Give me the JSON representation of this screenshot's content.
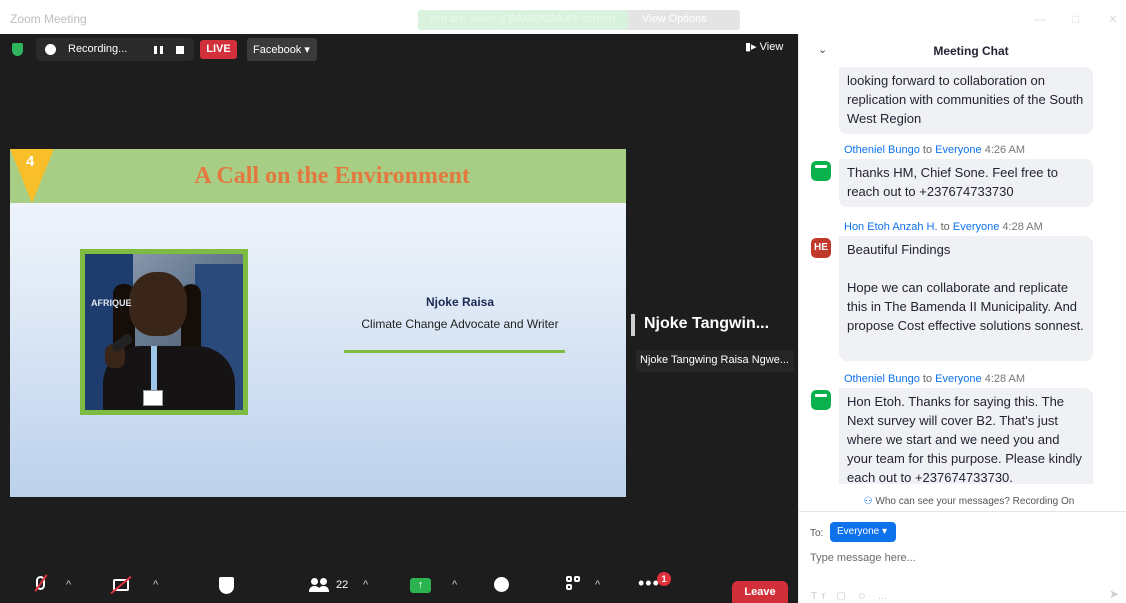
{
  "window": {
    "title": "Zoom Meeting",
    "banner_text": "You are viewing BAMENDA II's screen",
    "banner_button": "View Options",
    "minimize": "—",
    "maximize": "□",
    "close": "✕"
  },
  "topbar": {
    "recording_label": "Recording...",
    "live_label": "LIVE",
    "stream_target": "Facebook ▾",
    "view_label": "View"
  },
  "slide": {
    "number": "4",
    "title": "A Call on the Environment",
    "speaker_name": "Njoke Raisa",
    "speaker_role": "Climate Change Advocate and Writer",
    "photo_watermark": "AFRIQUE"
  },
  "participant": {
    "active_speaker": "Njoke Tangwin...",
    "name_tag": "Njoke Tangwing Raisa Ngwe..."
  },
  "toolbar": {
    "participants_count": "22",
    "more_badge": "1",
    "leave_label": "Leave",
    "caret": "^",
    "colors": {
      "mute_slash": "#e0323c",
      "share": "#2bb34f",
      "leave": "#d1303a"
    }
  },
  "chat": {
    "title": "Meeting Chat",
    "collapse_icon": "⌄",
    "messages": [
      {
        "text": "looking forward to collaboration on replication with communities of the South West Region"
      },
      {
        "sender": "Otheniel Bungo",
        "to": "to",
        "recipient": "Everyone",
        "time": "4:26 AM",
        "avatar": "",
        "text": "Thanks HM, Chief Sone. Feel free to reach out to +237674733730"
      },
      {
        "sender": "Hon Etoh Anzah H.",
        "to": "to",
        "recipient": "Everyone",
        "time": "4:28 AM",
        "avatar": "HE",
        "text": "Beautiful Findings",
        "text2": "Hope we can collaborate and replicate this in The Bamenda II Municipality. And propose Cost effective solutions sonnest."
      },
      {
        "sender": "Otheniel Bungo",
        "to": "to",
        "recipient": "Everyone",
        "time": "4:28 AM",
        "avatar": "",
        "text": "Hon Etoh. Thanks for saying this. The Next survey will cover B2. That's just where we start and we need you and your team for this purpose. Please kindly each out to +237674733730."
      }
    ],
    "visibility_note": "Who can see your messages? Recording On",
    "to_label": "To:",
    "to_value": "Everyone ▾",
    "input_placeholder": "Type message here...",
    "accent_color": "#0e72ed"
  }
}
